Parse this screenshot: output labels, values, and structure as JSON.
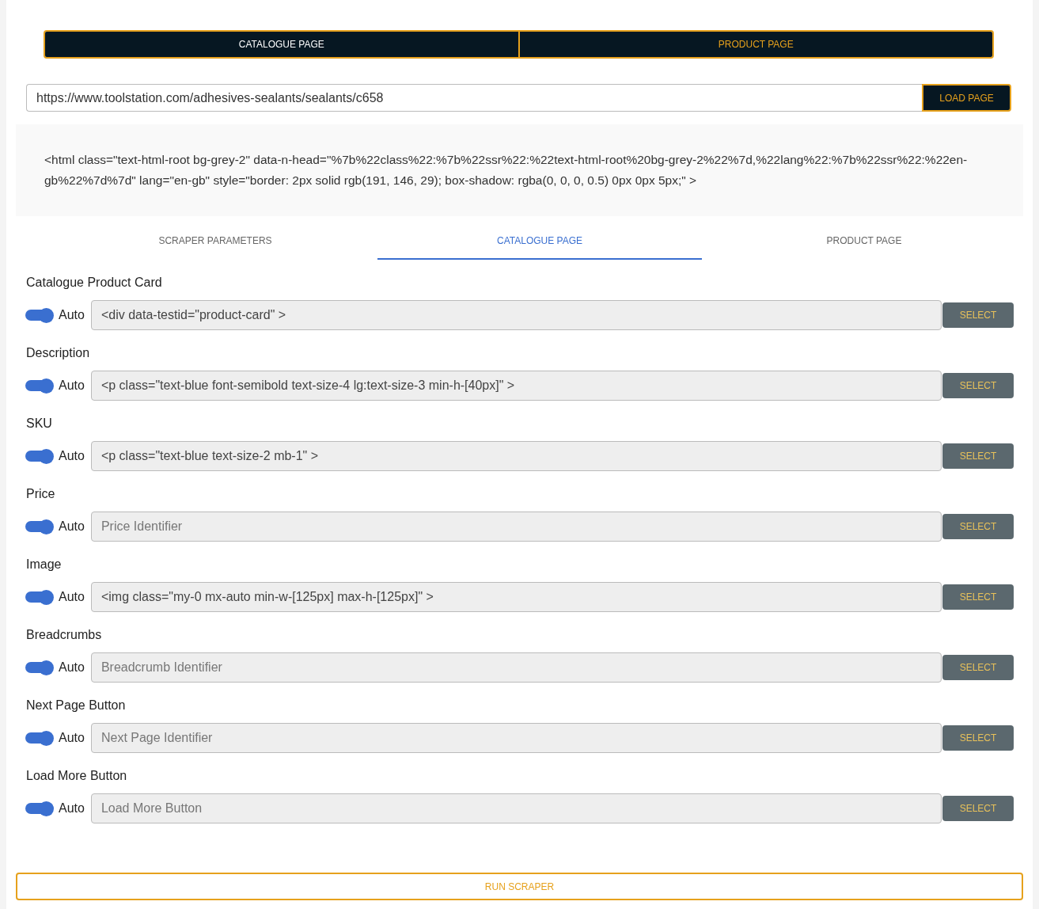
{
  "mode_toggle": [
    {
      "label": "CATALOGUE PAGE",
      "selected": true
    },
    {
      "label": "PRODUCT PAGE",
      "selected": false
    }
  ],
  "url_bar": {
    "value": "https://www.toolstation.com/adhesives-sealants/sealants/c658",
    "button": "LOAD PAGE"
  },
  "html_preview": "<html class=\"text-html-root bg-grey-2\" data-n-head=\"%7b%22class%22:%7b%22ssr%22:%22text-html-root%20bg-grey-2%22%7d,%22lang%22:%7b%22ssr%22:%22en-gb%22%7d%7d\" lang=\"en-gb\" style=\"border: 2px solid rgb(191, 146, 29); box-shadow: rgba(0, 0, 0, 0.5) 0px 0px 5px;\" >",
  "tabs": [
    {
      "label": "SCRAPER PARAMETERS",
      "selected": false
    },
    {
      "label": "CATALOGUE PAGE",
      "selected": true
    },
    {
      "label": "PRODUCT PAGE",
      "selected": false
    }
  ],
  "fields": [
    {
      "label": "Catalogue Product Card",
      "auto": true,
      "toggle_label": "Auto",
      "value": "<div data-testid=\"product-card\" >",
      "button": "SELECT"
    },
    {
      "label": "Description",
      "auto": true,
      "toggle_label": "Auto",
      "value": "<p class=\"text-blue font-semibold text-size-4 lg:text-size-3 min-h-[40px]\" >",
      "button": "SELECT"
    },
    {
      "label": "SKU",
      "auto": true,
      "toggle_label": "Auto",
      "value": "<p class=\"text-blue text-size-2 mb-1\" >",
      "button": "SELECT"
    },
    {
      "label": "Price",
      "auto": true,
      "toggle_label": "Auto",
      "placeholder": "Price Identifier",
      "button": "SELECT"
    },
    {
      "label": "Image",
      "auto": true,
      "toggle_label": "Auto",
      "value": "<img class=\"my-0 mx-auto min-w-[125px] max-h-[125px]\" >",
      "button": "SELECT"
    },
    {
      "label": "Breadcrumbs",
      "auto": true,
      "toggle_label": "Auto",
      "placeholder": "Breadcrumb Identifier",
      "button": "SELECT"
    },
    {
      "label": "Next Page Button",
      "auto": true,
      "toggle_label": "Auto",
      "placeholder": "Next Page Identifier",
      "button": "SELECT"
    },
    {
      "label": "Load More Button",
      "auto": true,
      "toggle_label": "Auto",
      "placeholder": "Load More Button",
      "button": "SELECT"
    }
  ],
  "run_button": "RUN SCRAPER"
}
